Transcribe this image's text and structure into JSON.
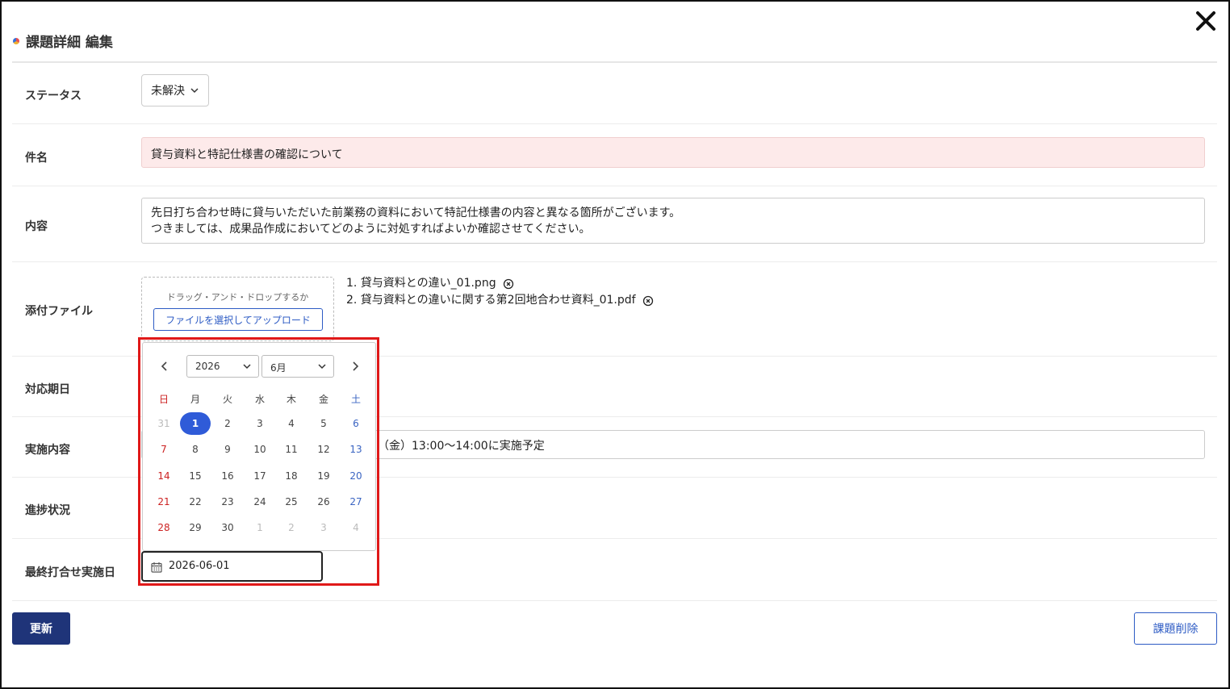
{
  "dialog": {
    "title": "課題詳細 編集"
  },
  "form": {
    "status": {
      "label": "ステータス",
      "value": "未解決"
    },
    "subject": {
      "label": "件名",
      "value": "貸与資料と特記仕様書の確認について"
    },
    "content": {
      "label": "内容",
      "line1": "先日打ち合わせ時に貸与いただいた前業務の資料において特記仕様書の内容と異なる箇所がございます。",
      "line2": "つきましては、成果品作成においてどのように対処すればよいか確認させてください。"
    },
    "attachments": {
      "label": "添付ファイル",
      "drop_hint": "ドラッグ・アンド・ドロップするか",
      "upload_label": "ファイルを選択してアップロード",
      "files": [
        "1. 貸与資料との違い_01.png",
        "2. 貸与資料との違いに関する第2回地合わせ資料_01.pdf"
      ]
    },
    "due_date": {
      "label": "対応期日"
    },
    "implementation": {
      "label": "実施内容",
      "value_visible": "（金）13:00～14:00に実施予定"
    },
    "progress": {
      "label": "進捗状況"
    },
    "last_meeting": {
      "label": "最終打合せ実施日",
      "value": "2026-06-01"
    }
  },
  "datepicker": {
    "year": "2026",
    "month": "6月",
    "weekdays": [
      "日",
      "月",
      "火",
      "水",
      "木",
      "金",
      "土"
    ],
    "weeks": [
      [
        "31",
        "1",
        "2",
        "3",
        "4",
        "5",
        "6"
      ],
      [
        "7",
        "8",
        "9",
        "10",
        "11",
        "12",
        "13"
      ],
      [
        "14",
        "15",
        "16",
        "17",
        "18",
        "19",
        "20"
      ],
      [
        "21",
        "22",
        "23",
        "24",
        "25",
        "26",
        "27"
      ],
      [
        "28",
        "29",
        "30",
        "1",
        "2",
        "3",
        "4"
      ]
    ],
    "selected": "1"
  },
  "actions": {
    "update_label": "更新",
    "delete_label": "課題削除"
  },
  "colors": {
    "primary": "#1f3479",
    "accent": "#2f5bd8",
    "highlight": "#e01919",
    "sunday": "#cc2222",
    "saturday": "#3a64c2",
    "error_bg": "#fdeaea"
  }
}
